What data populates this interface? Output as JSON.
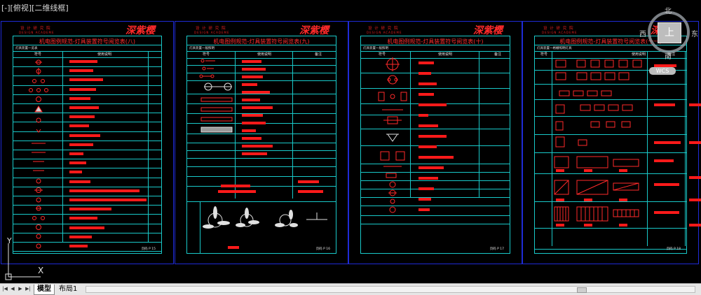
{
  "viewport": {
    "label": "[-][俯视][二维线框]"
  },
  "sheets": [
    {
      "id": "s1",
      "brand_small": "设 计 研 究 院",
      "brand_en": "DESIGN ACADEME",
      "brand_logo": "深紫樱",
      "title": "机电图例规范-灯具装置符号阅览表(八)",
      "subtitle": "灯具装置一览表",
      "col_symbol": "符号",
      "col_desc": "使用说明",
      "col_note": "",
      "page_label": "页码",
      "page_num": "P 15"
    },
    {
      "id": "s2",
      "brand_small": "设 计 研 究 院",
      "brand_en": "DESIGN ACADEME",
      "brand_logo": "深紫樱",
      "title": "机电图例规范-灯具装置符号阅览表(九)",
      "subtitle": "灯具装置一般照明",
      "col_symbol": "符号",
      "col_desc": "使用说明",
      "col_note": "备注",
      "page_label": "页码",
      "page_num": "P 16"
    },
    {
      "id": "s3",
      "brand_small": "设 计 研 究 院",
      "brand_en": "DESIGN ACADEME",
      "brand_logo": "深紫樱",
      "title": "机电图例规范-灯具装置符号阅览表(十)",
      "subtitle": "灯具装置一般照明",
      "col_symbol": "符号",
      "col_desc": "使用说明",
      "col_note": "备注",
      "page_label": "页码",
      "page_num": "P 17"
    },
    {
      "id": "s4",
      "brand_small": "设 计 研 究 院",
      "brand_en": "DESIGN ACADEME",
      "brand_logo": "深紫樱",
      "title": "机电图例规范-灯具装置符号阅览表(十一)",
      "subtitle": "灯具装置一格栅照明灯具",
      "col_symbol": "符号",
      "col_desc": "使用说明",
      "col_note": "备注",
      "page_label": "页码",
      "page_num": "P 18"
    }
  ],
  "viewcube": {
    "north": "北",
    "south": "南",
    "east": "东",
    "west": "西",
    "top": "上",
    "wcs": "WCS"
  },
  "ucs": {
    "y": "Y",
    "x": "X"
  },
  "tabs": {
    "nav": [
      "|◀",
      "◀",
      "▶",
      "▶|"
    ],
    "model": "模型",
    "layout1": "布局1"
  }
}
